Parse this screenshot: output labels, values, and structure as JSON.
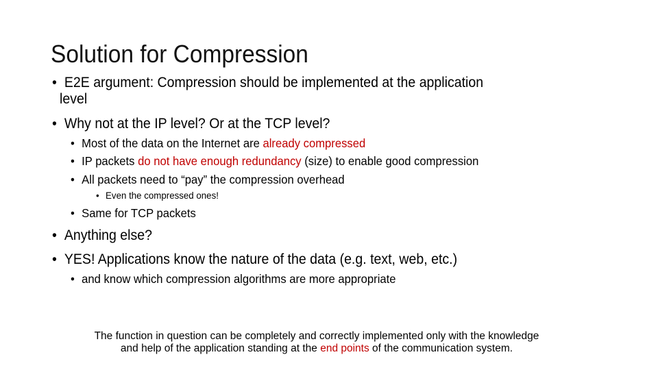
{
  "slide": {
    "title": "Solution for Compression",
    "bullet_char": "•",
    "items": [
      {
        "level": 1,
        "text_line1": "E2E argument: Compression should be implemented at the application",
        "text_line2": "level"
      },
      {
        "level": 1,
        "text": "Why not at the IP level? Or at the TCP level?"
      },
      {
        "level": 2,
        "parts": [
          "Most of the data on the Internet are ",
          "already compressed"
        ]
      },
      {
        "level": 2,
        "parts": [
          " IP packets ",
          "do not have enough redundancy",
          " (size) to enable good compression"
        ]
      },
      {
        "level": 2,
        "text": "All packets need to “pay” the compression overhead"
      },
      {
        "level": 3,
        "text": "Even the compressed ones!"
      },
      {
        "level": 2,
        "text": "Same for TCP packets"
      },
      {
        "level": 1,
        "text": "Anything else?"
      },
      {
        "level": 1,
        "text": "YES! Applications know the nature of the data (e.g. text, web, etc.)"
      },
      {
        "level": 2,
        "text": " and know which compression algorithms are more appropriate"
      }
    ],
    "footer": {
      "line1": "The function in question can be completely and correctly implemented  only with the knowledge",
      "line2_parts": [
        "and help  of the application standing at the  ",
        "end points",
        " of the communication system."
      ]
    },
    "colors": {
      "text": "#000000",
      "highlight": "#c00000",
      "background": "#ffffff"
    }
  }
}
